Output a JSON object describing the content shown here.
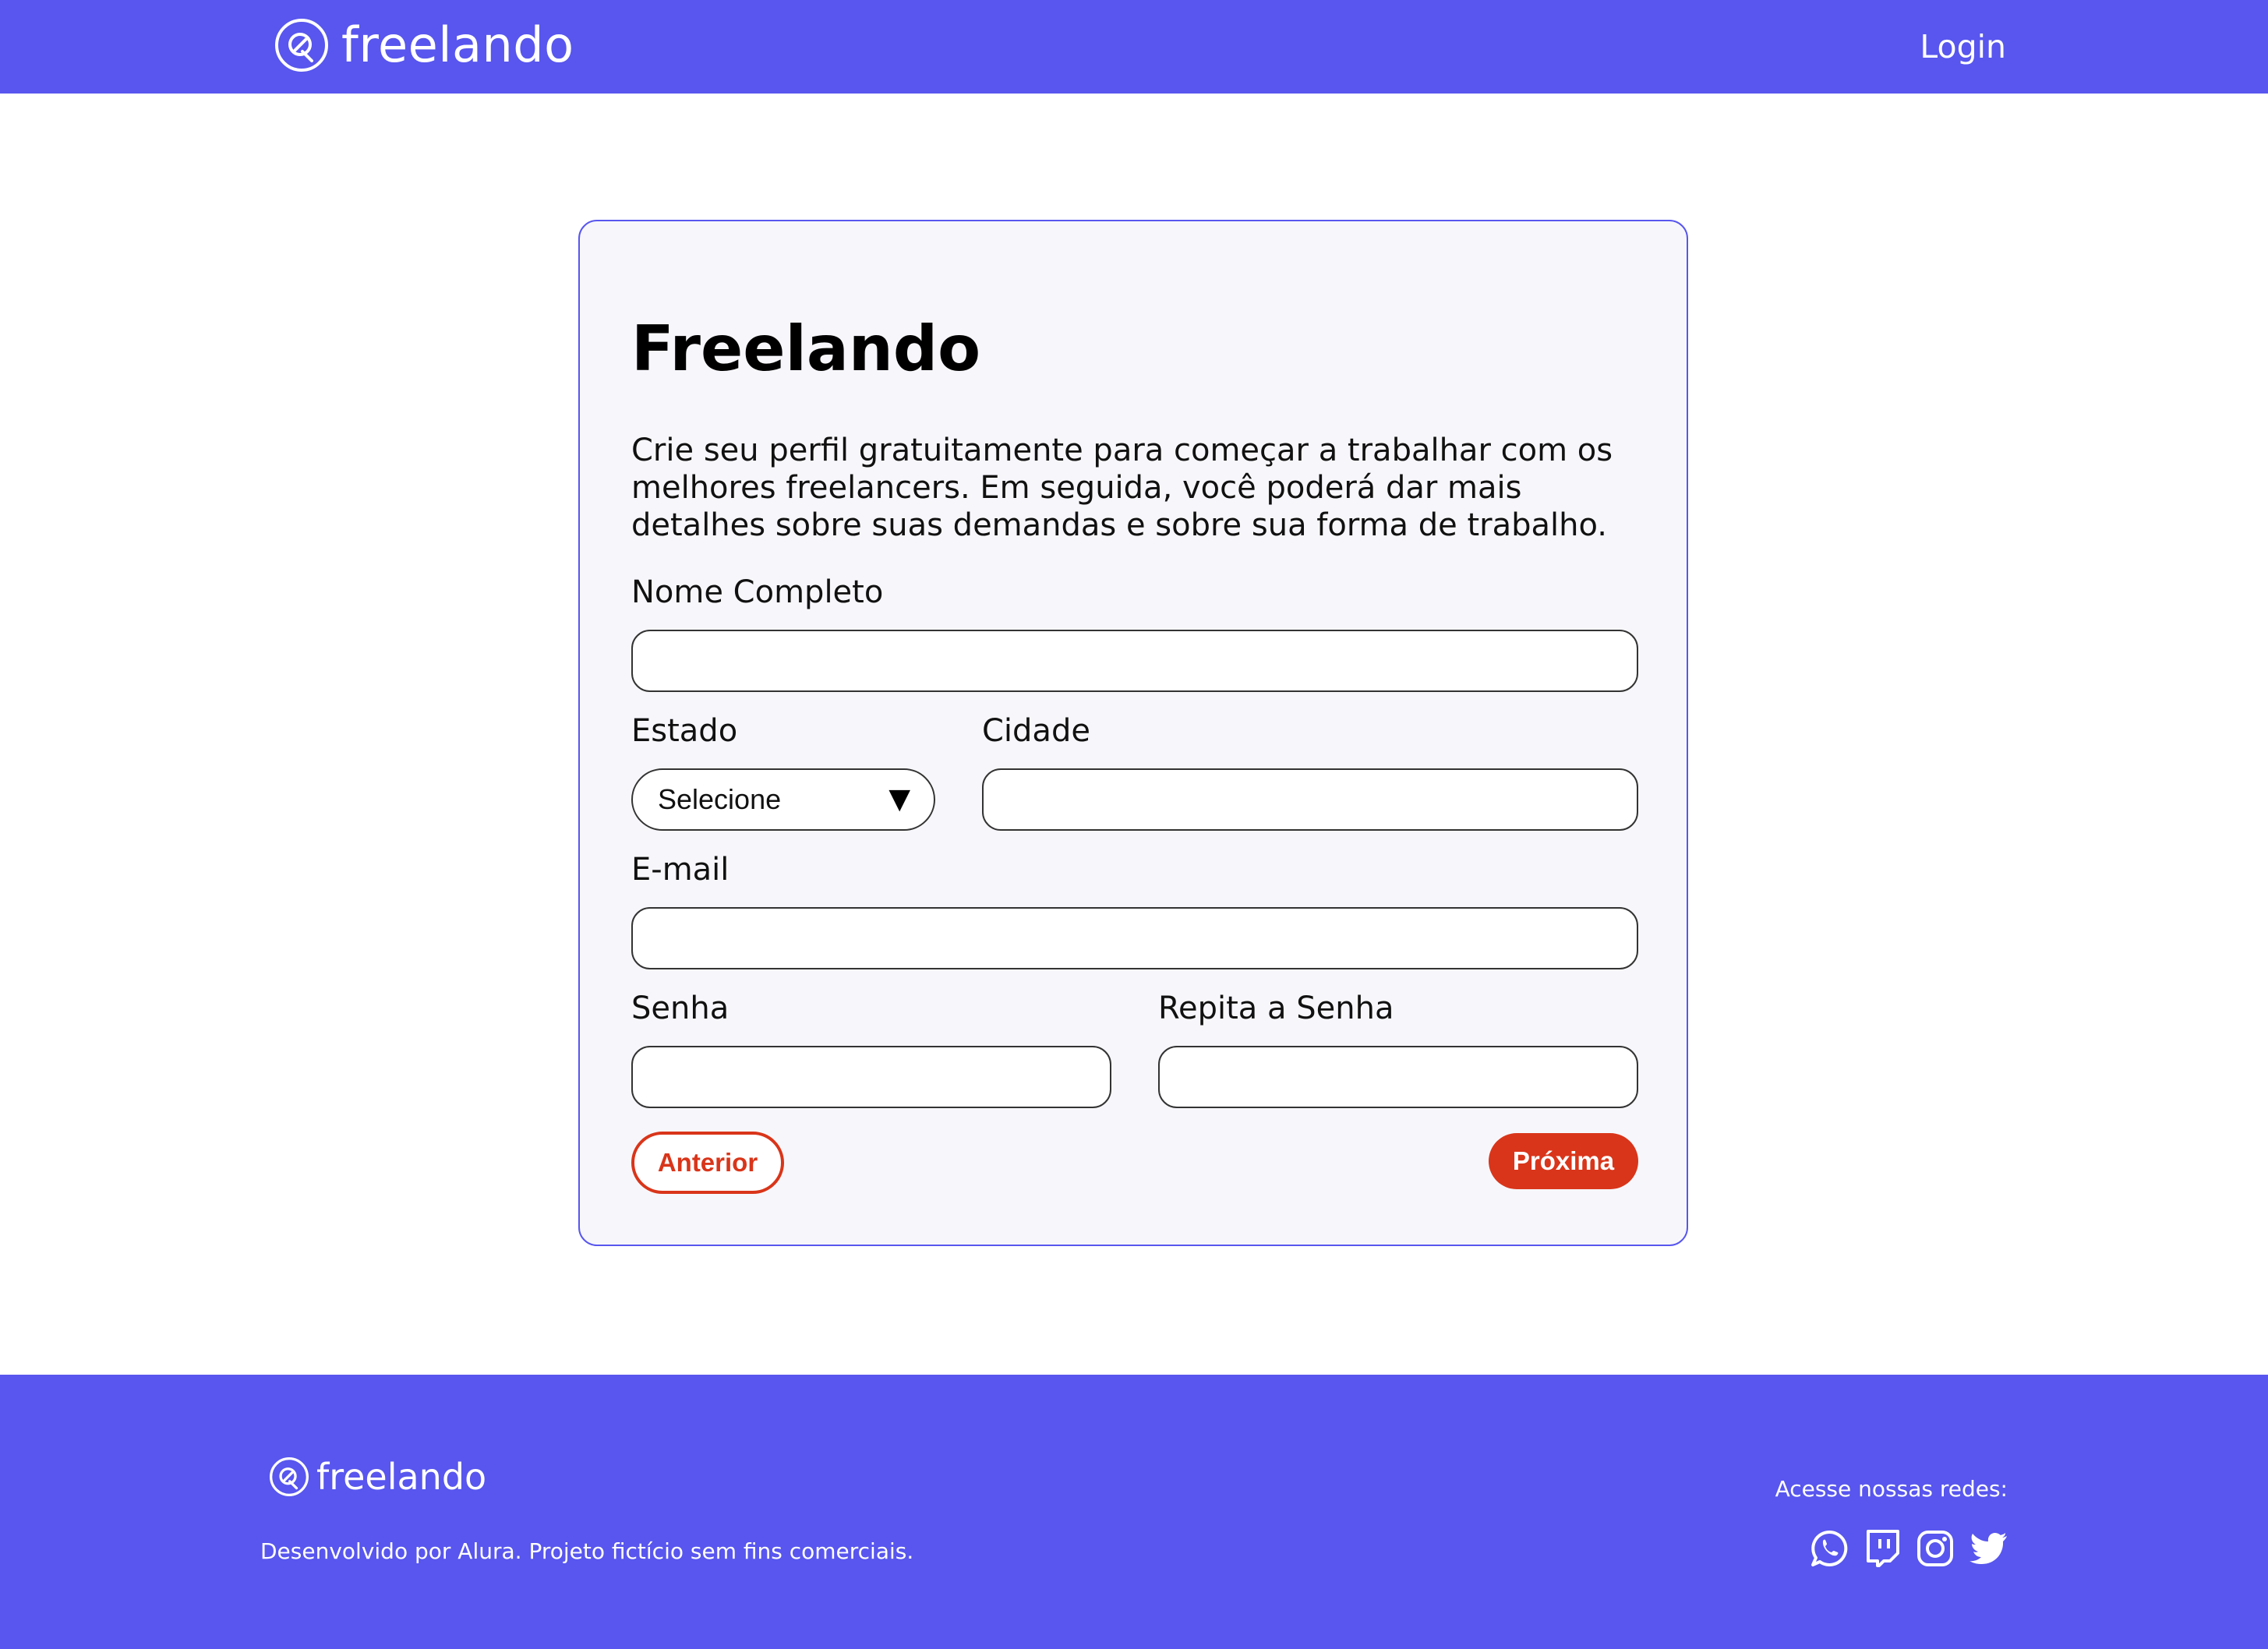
{
  "header": {
    "brand": "freelando",
    "login_label": "Login"
  },
  "form": {
    "title": "Freelando",
    "intro": "Crie seu perfil gratuitamente para começar a trabalhar com os melhores freelancers. Em seguida, você poderá dar mais detalhes sobre suas demandas e sobre sua forma de trabalho.",
    "fields": {
      "full_name": {
        "label": "Nome Completo",
        "value": ""
      },
      "state": {
        "label": "Estado",
        "selected": "Selecione"
      },
      "city": {
        "label": "Cidade",
        "value": ""
      },
      "email": {
        "label": "E-mail",
        "value": ""
      },
      "password": {
        "label": "Senha",
        "value": ""
      },
      "password_repeat": {
        "label": "Repita a Senha",
        "value": ""
      }
    },
    "prev_label": "Anterior",
    "next_label": "Próxima"
  },
  "footer": {
    "brand": "freelando",
    "note": "Desenvolvido por Alura. Projeto fictício sem fins comerciais.",
    "social_title": "Acesse nossas redes:",
    "social_icons": [
      "whatsapp-icon",
      "twitch-icon",
      "instagram-icon",
      "twitter-icon"
    ]
  },
  "colors": {
    "primary": "#5856EE",
    "accent": "#D9351A",
    "card_background": "#F7F7FB"
  }
}
